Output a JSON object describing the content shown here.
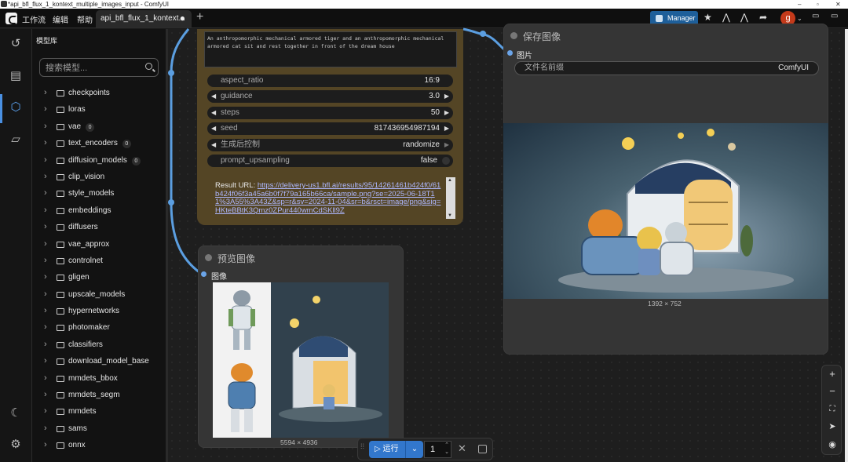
{
  "window": {
    "title": "*api_bfl_flux_1_kontext_multiple_images_input - ComfyUI",
    "controls": [
      "–",
      "▫",
      "✕"
    ]
  },
  "menubar": {
    "items": [
      "工作流",
      "编辑",
      "帮助"
    ],
    "active_tab": "api_bfl_flux_1_kontext...",
    "tab_modified_dot": "●",
    "new_tab": "+",
    "manager_label": "Manager",
    "avatar_letter": "g"
  },
  "sidebar": {
    "title": "模型库",
    "search_placeholder": "搜索模型...",
    "folders": [
      {
        "name": "checkpoints",
        "badge": ""
      },
      {
        "name": "loras",
        "badge": ""
      },
      {
        "name": "vae",
        "badge": "0"
      },
      {
        "name": "text_encoders",
        "badge": "0"
      },
      {
        "name": "diffusion_models",
        "badge": "0"
      },
      {
        "name": "clip_vision",
        "badge": ""
      },
      {
        "name": "style_models",
        "badge": ""
      },
      {
        "name": "embeddings",
        "badge": ""
      },
      {
        "name": "diffusers",
        "badge": ""
      },
      {
        "name": "vae_approx",
        "badge": ""
      },
      {
        "name": "controlnet",
        "badge": ""
      },
      {
        "name": "gligen",
        "badge": ""
      },
      {
        "name": "upscale_models",
        "badge": ""
      },
      {
        "name": "hypernetworks",
        "badge": ""
      },
      {
        "name": "photomaker",
        "badge": ""
      },
      {
        "name": "classifiers",
        "badge": ""
      },
      {
        "name": "download_model_base",
        "badge": ""
      },
      {
        "name": "mmdets_bbox",
        "badge": ""
      },
      {
        "name": "mmdets_segm",
        "badge": ""
      },
      {
        "name": "mmdets",
        "badge": ""
      },
      {
        "name": "sams",
        "badge": ""
      },
      {
        "name": "onnx",
        "badge": ""
      }
    ]
  },
  "flux_node": {
    "prompt": "An anthropomorphic mechanical armored tiger and an anthropomorphic mechanical armored cat sit and rest together in front of the dream house",
    "widgets": [
      {
        "label": "aspect_ratio",
        "value": "16:9",
        "kind": "text"
      },
      {
        "label": "guidance",
        "value": "3.0",
        "kind": "number"
      },
      {
        "label": "steps",
        "value": "50",
        "kind": "number"
      },
      {
        "label": "seed",
        "value": "817436954987194",
        "kind": "number"
      },
      {
        "label": "生成后控制",
        "value": "randomize",
        "kind": "combo"
      },
      {
        "label": "prompt_upsampling",
        "value": "false",
        "kind": "toggle"
      }
    ],
    "result_label": "Result URL:",
    "result_url": "https://delivery-us1.bfl.ai/results/95/14261461b424f0/61b424f06f3a45a6b0f7f79a165b66ca/sample.png?se=2025-06-18T11%3A55%3A43Z&sp=r&sv=2024-11-04&sr=b&rsct=image/png&sig=HKteBBtK3Qmz0ZPur440wmCdSKll9Z"
  },
  "preview_node": {
    "title": "预览图像",
    "input_label": "图像",
    "dimensions": "5594 × 4936"
  },
  "save_node": {
    "title": "保存图像",
    "input_label": "图片",
    "filename_prefix_label": "文件名前缀",
    "filename_prefix_value": "ComfyUI",
    "dimensions": "1392 × 752"
  },
  "runbar": {
    "run_label": "运行",
    "batch_count": "1"
  },
  "colors": {
    "accent": "#3277cc",
    "port": "#6ba4e8",
    "gold_node": "#544525",
    "node_bg": "#353535"
  }
}
